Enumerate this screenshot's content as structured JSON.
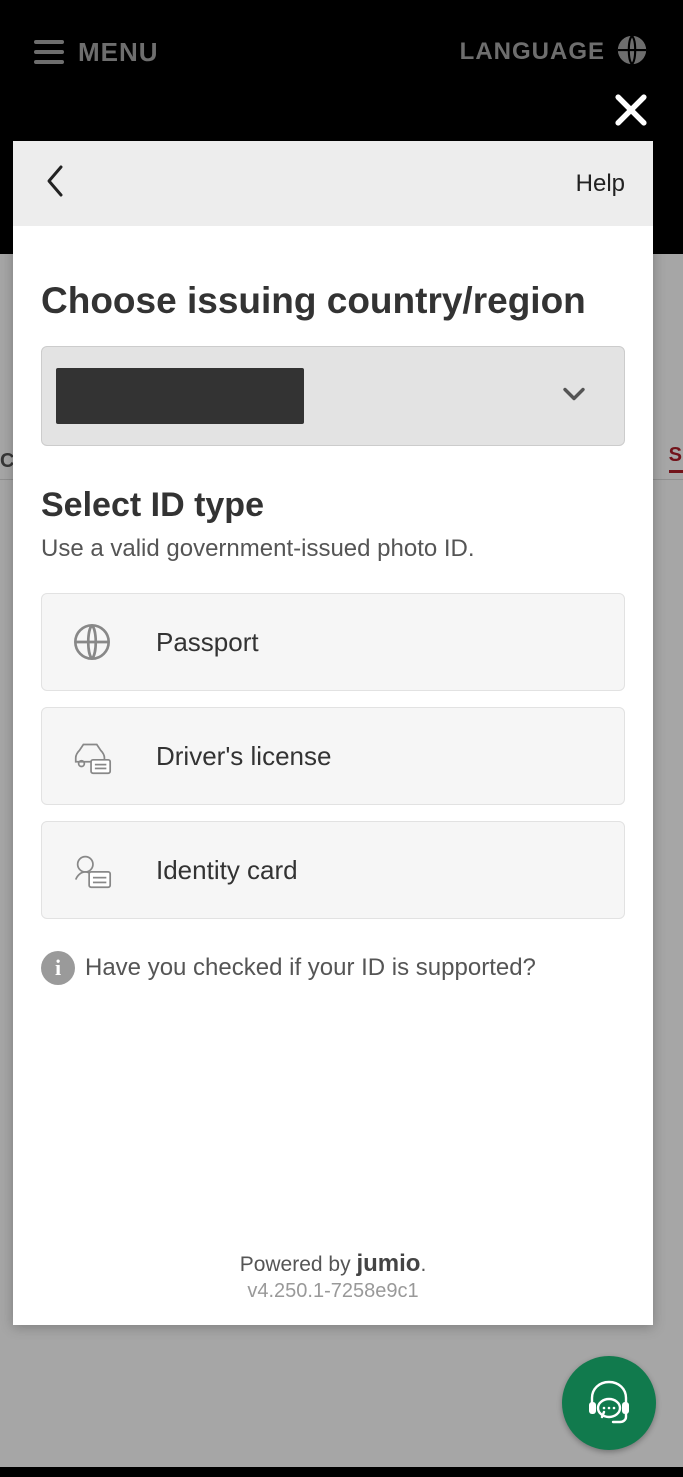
{
  "topbar": {
    "menu_label": "MENU",
    "language_label": "LANGUAGE"
  },
  "bg_tabs": {
    "left": "C",
    "right": "S"
  },
  "modal": {
    "help_label": "Help",
    "title_country": "Choose issuing country/region",
    "title_id": "Select ID type",
    "subtitle_id": "Use a valid government-issued photo ID.",
    "options": [
      {
        "label": "Passport"
      },
      {
        "label": "Driver's license"
      },
      {
        "label": "Identity card"
      }
    ],
    "supported_text": "Have you checked if your ID is supported?",
    "powered_prefix": "Powered by ",
    "powered_brand": "jumio",
    "version": "v4.250.1-7258e9c1"
  }
}
